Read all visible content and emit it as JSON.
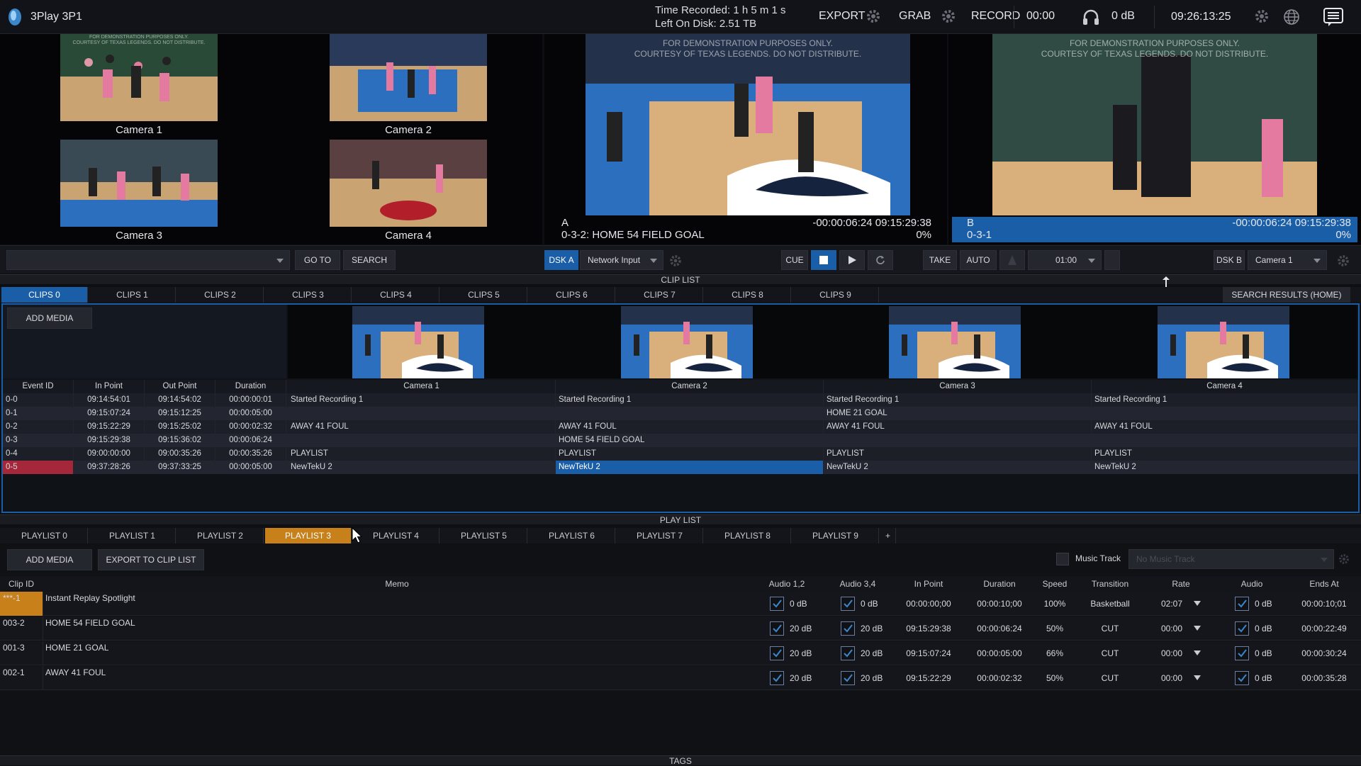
{
  "app": {
    "name": "3Play 3P1"
  },
  "topbar": {
    "time_recorded": "Time Recorded:  1 h 5 m 1 s",
    "left_on_disk": "Left On Disk:   2.51 TB",
    "export": "EXPORT",
    "grab": "GRAB",
    "record": "RECORD",
    "record_time": "00:00",
    "volume": "0 dB",
    "clock": "09:26:13:25",
    "icons": [
      "logo-icon",
      "gear-icon",
      "headphones-icon",
      "globe-icon",
      "menu-icon"
    ]
  },
  "multiview": {
    "cameras": [
      {
        "label": "Camera 1"
      },
      {
        "label": "Camera 2"
      },
      {
        "label": "Camera 3"
      },
      {
        "label": "Camera 4"
      }
    ],
    "watermark_small": "FOR DEMONSTRATION PURPOSES ONLY. COURTESY OF TEXAS LEGENDS. DO NOT DISTRIBUTE."
  },
  "monitor_a": {
    "letter": "A",
    "event": "0-3-2: HOME 54 FIELD GOAL",
    "timecode": "-00:00:06:24  09:15:29:38",
    "percent": "0%",
    "watermark_line1": "FOR DEMONSTRATION PURPOSES ONLY.",
    "watermark_line2": "COURTESY OF TEXAS LEGENDS. DO NOT DISTRIBUTE."
  },
  "monitor_b": {
    "letter": "B",
    "event": "0-3-1",
    "timecode": "-00:00:06:24  09:15:29:38",
    "percent": "0%",
    "watermark_line1": "FOR DEMONSTRATION PURPOSES ONLY.",
    "watermark_line2": "COURTESY OF TEXAS LEGENDS. DO NOT DISTRIBUTE."
  },
  "controls": {
    "goto": "GO TO",
    "search": "SEARCH",
    "dsk_a": "DSK A",
    "dsk_a_source": "Network Input",
    "cue": "CUE",
    "take": "TAKE",
    "auto": "AUTO",
    "transition_time": "01:00",
    "dsk_b": "DSK B",
    "dsk_b_source": "Camera 1"
  },
  "cliplist": {
    "header": "CLIP LIST",
    "tabs": [
      "CLIPS 0",
      "CLIPS 1",
      "CLIPS 2",
      "CLIPS 3",
      "CLIPS 4",
      "CLIPS 5",
      "CLIPS 6",
      "CLIPS 7",
      "CLIPS 8",
      "CLIPS 9"
    ],
    "search_results": "SEARCH RESULTS (HOME)",
    "add_media": "ADD MEDIA",
    "columns": [
      "Event ID",
      "In Point",
      "Out Point",
      "Duration",
      "Camera 1",
      "Camera 2",
      "Camera 3",
      "Camera 4"
    ],
    "rows": [
      {
        "id": "0-0",
        "in": "09:14:54:01",
        "out": "09:14:54:02",
        "dur": "00:00:00:01",
        "c1": "Started Recording 1",
        "c2": "Started Recording 1",
        "c3": "Started Recording 1",
        "c4": "Started Recording 1"
      },
      {
        "id": "0-1",
        "in": "09:15:07:24",
        "out": "09:15:12:25",
        "dur": "00:00:05:00",
        "c1": "",
        "c2": "",
        "c3": "HOME 21 GOAL",
        "c4": ""
      },
      {
        "id": "0-2",
        "in": "09:15:22:29",
        "out": "09:15:25:02",
        "dur": "00:00:02:32",
        "c1": "AWAY 41 FOUL",
        "c2": "AWAY 41 FOUL",
        "c3": "AWAY 41 FOUL",
        "c4": "AWAY 41 FOUL"
      },
      {
        "id": "0-3",
        "in": "09:15:29:38",
        "out": "09:15:36:02",
        "dur": "00:00:06:24",
        "c1": "",
        "c2": "HOME 54 FIELD GOAL",
        "c3": "",
        "c4": ""
      },
      {
        "id": "0-4",
        "in": "09:00:00:00",
        "out": "09:00:35:26",
        "dur": "00:00:35:26",
        "c1": "PLAYLIST",
        "c2": "PLAYLIST",
        "c3": "PLAYLIST",
        "c4": "PLAYLIST"
      },
      {
        "id": "0-5",
        "in": "09:37:28:26",
        "out": "09:37:33:25",
        "dur": "00:00:05:00",
        "c1": "NewTekU 2",
        "c2": "NewTekU 2",
        "c3": "NewTekU 2",
        "c4": "NewTekU 2"
      }
    ]
  },
  "playlist": {
    "header": "PLAY LIST",
    "tabs": [
      "PLAYLIST 0",
      "PLAYLIST 1",
      "PLAYLIST 2",
      "PLAYLIST 3",
      "PLAYLIST 4",
      "PLAYLIST 5",
      "PLAYLIST 6",
      "PLAYLIST 7",
      "PLAYLIST 8",
      "PLAYLIST 9"
    ],
    "add_tab": "+",
    "add_media": "ADD MEDIA",
    "export_to_clip_list": "EXPORT TO CLIP LIST",
    "music_track_label": "Music Track",
    "music_track_placeholder": "No Music Track",
    "columns": [
      "Clip ID",
      "Memo",
      "Audio 1,2",
      "Audio 3,4",
      "In Point",
      "Duration",
      "Speed",
      "Transition",
      "Rate",
      "Audio",
      "Ends At"
    ],
    "rows": [
      {
        "id": "***-1",
        "memo": "Instant Replay Spotlight",
        "a12": "0 dB",
        "a34": "0 dB",
        "in": "00:00:00;00",
        "dur": "00:00:10;00",
        "speed": "100%",
        "transition": "Basketball",
        "rate": "02:07",
        "audio": "0 dB",
        "ends": "00:00:10;01"
      },
      {
        "id": "003-2",
        "memo": "HOME 54 FIELD GOAL",
        "a12": "20 dB",
        "a34": "20 dB",
        "in": "09:15:29:38",
        "dur": "00:00:06:24",
        "speed": "50%",
        "transition": "CUT",
        "rate": "00:00",
        "audio": "0 dB",
        "ends": "00:00:22:49"
      },
      {
        "id": "001-3",
        "memo": "HOME 21 GOAL",
        "a12": "20 dB",
        "a34": "20 dB",
        "in": "09:15:07:24",
        "dur": "00:00:05:00",
        "speed": "66%",
        "transition": "CUT",
        "rate": "00:00",
        "audio": "0 dB",
        "ends": "00:00:30:24"
      },
      {
        "id": "002-1",
        "memo": "AWAY 41 FOUL",
        "a12": "20 dB",
        "a34": "20 dB",
        "in": "09:15:22:29",
        "dur": "00:00:02:32",
        "speed": "50%",
        "transition": "CUT",
        "rate": "00:00",
        "audio": "0 dB",
        "ends": "00:00:35:28"
      }
    ]
  },
  "tags": {
    "label": "TAGS"
  },
  "colors": {
    "accent": "#1a5ea8",
    "active_playlist": "#c8801a",
    "selected_event": "#a5283a"
  }
}
